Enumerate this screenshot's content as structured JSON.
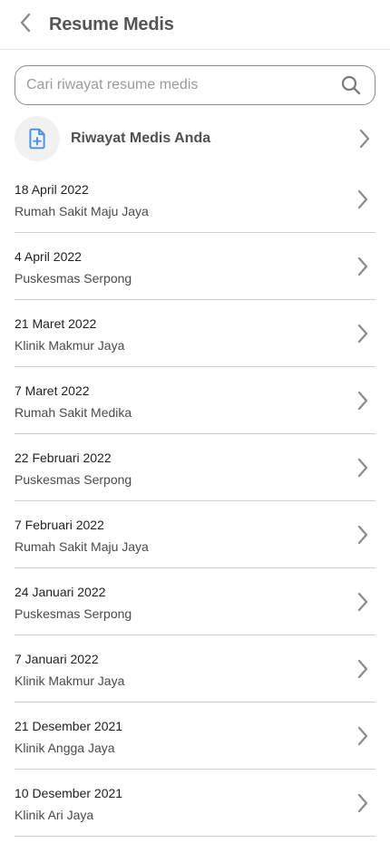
{
  "header": {
    "title": "Resume Medis",
    "back_icon": "chevron-left-icon"
  },
  "search": {
    "placeholder": "Cari riwayat resume medis",
    "value": "",
    "icon": "search-icon"
  },
  "history": {
    "title": "Riwayat Medis Anda",
    "icon": "medical-document-icon",
    "accent_color": "#4a90e2"
  },
  "records": [
    {
      "date": "18 April 2022",
      "place": "Rumah Sakit Maju Jaya"
    },
    {
      "date": "4 April 2022",
      "place": "Puskesmas Serpong"
    },
    {
      "date": "21 Maret 2022",
      "place": "Klinik Makmur Jaya"
    },
    {
      "date": "7 Maret 2022",
      "place": "Rumah Sakit Medika"
    },
    {
      "date": "22 Februari 2022",
      "place": "Puskesmas Serpong"
    },
    {
      "date": "7 Februari 2022",
      "place": "Rumah Sakit Maju Jaya"
    },
    {
      "date": "24 Januari 2022",
      "place": "Puskesmas Serpong"
    },
    {
      "date": "7 Januari 2022",
      "place": "Klinik Makmur Jaya"
    },
    {
      "date": "21 Desember 2021",
      "place": "Klinik Angga Jaya"
    },
    {
      "date": "10 Desember 2021",
      "place": "Klinik Ari Jaya"
    }
  ]
}
